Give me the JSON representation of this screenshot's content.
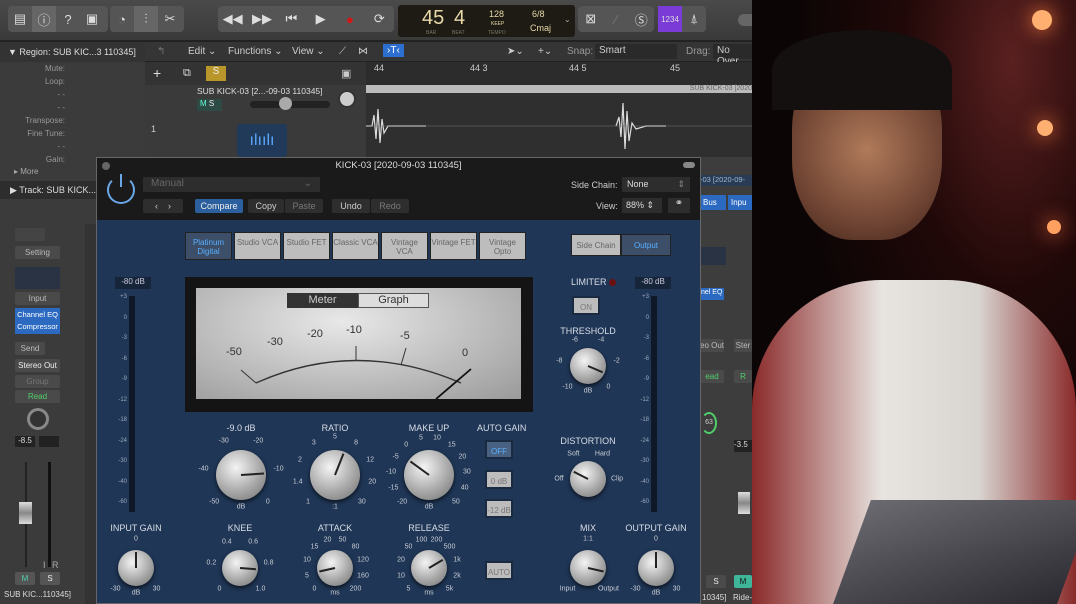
{
  "toolbar": {
    "icons": [
      "library-icon",
      "inspector-icon",
      "help-icon",
      "toolbar-icon",
      "smart-controls-icon",
      "mixer-icon",
      "editors-icon"
    ],
    "transport": [
      "rewind-icon",
      "forward-icon",
      "go-to-start-icon",
      "play-icon",
      "record-icon",
      "cycle-icon"
    ],
    "lcd": {
      "bar": "45",
      "beat": "4",
      "bar_label": "BAR",
      "beat_label": "BEAT",
      "tempo": "128",
      "tempo_mode": "KEEP",
      "tempo_label": "TEMPO",
      "signature": "6/8",
      "key": "Cmaj"
    },
    "right_icons": [
      "replace-icon",
      "pencil-icon",
      "solo-icon"
    ],
    "count_in": "1234",
    "metronome": "metronome-icon"
  },
  "inspector": {
    "region_title": "Region: SUB KIC...3 110345]",
    "mute": "Mute:",
    "loop": "Loop:",
    "dash1": "- -",
    "dash2": "- -",
    "transpose": "Transpose:",
    "fine_tune": "Fine Tune:",
    "dash3": "- -",
    "gain": "Gain:",
    "more": "More",
    "track_title": "Track:  SUB KICK...",
    "strip": {
      "setting": "Setting",
      "input": "Input",
      "eq": "Channel EQ",
      "comp": "Compressor",
      "send": "Send",
      "output": "Stereo Out",
      "group": "Group",
      "automation": "Read",
      "volume": "-8.5",
      "m": "M",
      "s": "S",
      "i": "I",
      "r": "R",
      "name": "SUB KIC...110345]"
    }
  },
  "editor": {
    "menus": [
      "Edit",
      "Functions",
      "View"
    ],
    "snap_label": "Snap:",
    "snap": "Smart",
    "drag_label": "Drag:",
    "drag": "No Over",
    "ruler": [
      "44",
      "44 3",
      "44 5",
      "45"
    ],
    "solo": "S",
    "track_number": "1",
    "track_name": "SUB KICK-03 [2...-09-03 110345]",
    "region_name": "SUB KICK-03 [2020",
    "m": "M",
    "s": "S"
  },
  "plugin": {
    "title": "KICK-03 [2020-09-03 110345]",
    "preset": "Manual",
    "compare": "Compare",
    "copy": "Copy",
    "paste": "Paste",
    "undo": "Undo",
    "redo": "Redo",
    "side_chain_label": "Side Chain:",
    "side_chain": "None",
    "view_label": "View:",
    "view": "88%",
    "models": [
      "Platinum Digital",
      "Studio VCA",
      "Studio FET",
      "Classic VCA",
      "Vintage VCA",
      "Vintage FET",
      "Vintage Opto"
    ],
    "active_model": "Platinum Digital",
    "sc_button": "Side Chain",
    "output_button": "Output",
    "meter_tabs": [
      "Meter",
      "Graph"
    ],
    "meter_scale": [
      "-50",
      "-30",
      "-20",
      "-10",
      "-5",
      "0"
    ],
    "input_readout": "-80 dB",
    "output_readout": "-80 dB",
    "level_scale": [
      "+3",
      "0",
      "-3",
      "-6",
      "-9",
      "-12",
      "-18",
      "-24",
      "-30",
      "-40",
      "-60"
    ],
    "limiter": "LIMITER",
    "limiter_on": "ON",
    "auto_gain": "AUTO GAIN",
    "auto_gain_buttons": [
      "OFF",
      "0 dB",
      "-12 dB"
    ],
    "auto": "AUTO",
    "knobs": [
      {
        "id": "threshold",
        "label": "-9.0 dB",
        "scale": [
          "-50",
          "-40",
          "-30",
          "-20",
          "-10",
          "0"
        ],
        "unit": "dB",
        "value": 0.82
      },
      {
        "id": "ratio",
        "label": "RATIO",
        "scale": [
          "1",
          "1.4",
          "2",
          "3",
          "5",
          "8",
          "12",
          "20",
          "30"
        ],
        "unit": ":1",
        "value": 0.58
      },
      {
        "id": "make-up",
        "label": "MAKE UP",
        "scale": [
          "-20",
          "-15",
          "-10",
          "-5",
          "0",
          "5",
          "10",
          "15",
          "20",
          "30",
          "40",
          "50"
        ],
        "unit": "dB",
        "value": 0.3
      },
      {
        "id": "input-gain",
        "label": "INPUT GAIN",
        "scale": [
          "-30",
          "0",
          "30"
        ],
        "unit": "dB",
        "value": 0.5
      },
      {
        "id": "knee",
        "label": "KNEE",
        "scale": [
          "0",
          "0.2",
          "0.4",
          "0.6",
          "0.8",
          "1.0"
        ],
        "unit": "",
        "value": 0.85
      },
      {
        "id": "attack",
        "label": "ATTACK",
        "scale": [
          "0",
          "5",
          "10",
          "15",
          "20",
          "50",
          "80",
          "120",
          "160",
          "200"
        ],
        "unit": "ms",
        "value": 0.12
      },
      {
        "id": "release",
        "label": "RELEASE",
        "scale": [
          "5",
          "10",
          "20",
          "50",
          "100",
          "200",
          "500",
          "1k",
          "2k",
          "5k"
        ],
        "unit": "ms",
        "value": 0.72
      },
      {
        "id": "limiter-threshold",
        "label": "THRESHOLD",
        "scale": [
          "-10",
          "-8",
          "-6",
          "-4",
          "-2",
          "0"
        ],
        "unit": "dB",
        "value": 0.92
      },
      {
        "id": "distortion",
        "label": "DISTORTION",
        "scale": [
          "Off",
          "Soft",
          "Hard",
          "Clip"
        ],
        "unit": "",
        "value": 0.15
      },
      {
        "id": "mix",
        "label": "MIX",
        "scale": [
          "Input",
          "1:1",
          "Output"
        ],
        "unit": "",
        "value": 0.88
      },
      {
        "id": "output-gain",
        "label": "OUTPUT GAIN",
        "scale": [
          "-30",
          "0",
          "30"
        ],
        "unit": "dB",
        "value": 0.5
      }
    ]
  },
  "mixer_right": {
    "name1": "-03 [2020-09-",
    "bus": "Bus",
    "input": "Inpu",
    "eq": "nel EQ",
    "out1": "eo Out",
    "out2": "Ster",
    "read1": "ead",
    "read2": "R",
    "pan": "63",
    "vol": "-3.5",
    "s": "S",
    "m": "M",
    "label1": "10345]",
    "label2": "Ride-"
  },
  "colors": {
    "accent": "#3b82d6",
    "plugin_bg": "#1f3656",
    "solo": "#b8962a",
    "count_in": "#7a3bd6",
    "read": "#4fd06a"
  }
}
